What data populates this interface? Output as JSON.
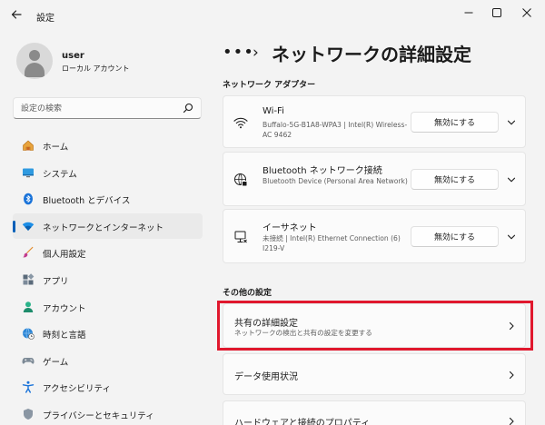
{
  "window": {
    "title": "設定",
    "controls": {
      "minimize": "—",
      "maximize": "",
      "close": "✕"
    }
  },
  "user": {
    "name": "user",
    "account_type": "ローカル アカウント"
  },
  "search": {
    "placeholder": "設定の検索"
  },
  "sidebar": {
    "items": [
      {
        "label": "ホーム",
        "icon": "home-icon",
        "active": false
      },
      {
        "label": "システム",
        "icon": "system-icon",
        "active": false
      },
      {
        "label": "Bluetooth とデバイス",
        "icon": "bluetooth-icon",
        "active": false
      },
      {
        "label": "ネットワークとインターネット",
        "icon": "network-icon",
        "active": true
      },
      {
        "label": "個人用設定",
        "icon": "brush-icon",
        "active": false
      },
      {
        "label": "アプリ",
        "icon": "apps-icon",
        "active": false
      },
      {
        "label": "アカウント",
        "icon": "account-icon",
        "active": false
      },
      {
        "label": "時刻と言語",
        "icon": "globe-clock-icon",
        "active": false
      },
      {
        "label": "ゲーム",
        "icon": "gamepad-icon",
        "active": false
      },
      {
        "label": "アクセシビリティ",
        "icon": "accessibility-icon",
        "active": false
      },
      {
        "label": "プライバシーとセキュリティ",
        "icon": "shield-icon",
        "active": false
      }
    ]
  },
  "breadcrumb": {
    "overflow": "•••",
    "separator": "›",
    "title": "ネットワークの詳細設定"
  },
  "adapters": {
    "heading": "ネットワーク アダプター",
    "items": [
      {
        "name": "Wi-Fi",
        "description": "Buffalo-5G-B1A8-WPA3 | Intel(R) Wireless-AC 9462",
        "button": "無効にする",
        "icon": "wifi-icon"
      },
      {
        "name": "Bluetooth ネットワーク接続",
        "description": "Bluetooth Device (Personal Area Network)",
        "button": "無効にする",
        "icon": "globe-icon"
      },
      {
        "name": "イーサネット",
        "description": "未接続 | Intel(R) Ethernet Connection (6) I219-V",
        "button": "無効にする",
        "icon": "ethernet-icon"
      }
    ]
  },
  "other_settings": {
    "heading": "その他の設定",
    "items": [
      {
        "name": "共有の詳細設定",
        "description": "ネットワークの検出と共有の設定を変更する"
      },
      {
        "name": "データ使用状況",
        "description": ""
      },
      {
        "name": "ハードウェアと接続のプロパティ",
        "description": ""
      }
    ]
  },
  "colors": {
    "accent": "#005fb8",
    "highlight_box": "#e0182d",
    "background": "#f3f3f3",
    "card": "#fbfbfb"
  }
}
